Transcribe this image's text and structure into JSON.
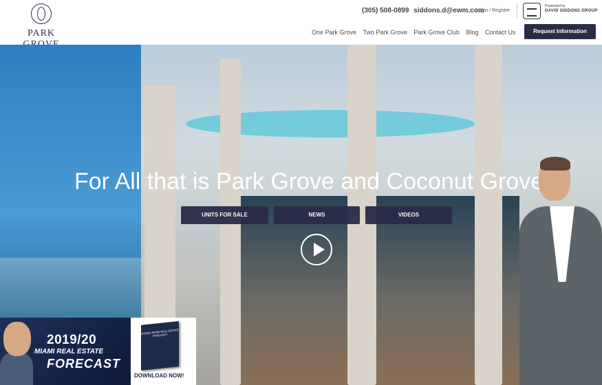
{
  "brand": {
    "logo_text": "PARK GROVE"
  },
  "header": {
    "phone": "(305) 508-0899",
    "email": "siddons.d@ewm.com",
    "login": "Login",
    "sep": "/",
    "register": "Register",
    "presented_by": "Presented by",
    "presenter_name": "DAVID SIDDONS GROUP"
  },
  "nav": {
    "items": [
      "One Park Grove",
      "Two Park Grove",
      "Park Grove Club",
      "Blog",
      "Contact Us"
    ],
    "cta": "Request Information"
  },
  "hero": {
    "headline": "For All that is Park Grove and Coconut Grove!",
    "buttons": [
      "UNITS FOR SALE",
      "NEWS",
      "VIDEOS"
    ]
  },
  "promo": {
    "year": "2019/20",
    "subtitle": "MIAMI REAL ESTATE",
    "title": "FORECAST",
    "book_title": "2019/20 MIAMI REAL ESTATE FORECAST",
    "cta": "DOWNLOAD NOW!"
  }
}
